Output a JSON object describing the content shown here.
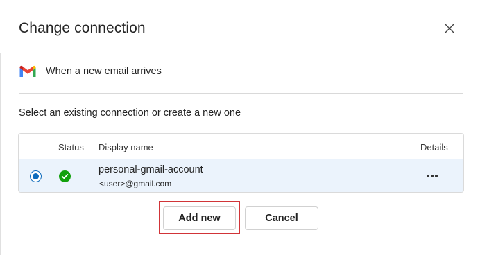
{
  "dialog": {
    "title": "Change connection",
    "close_icon": "close-icon"
  },
  "trigger": {
    "icon": "gmail-icon",
    "label": "When a new email arrives"
  },
  "prompt": "Select an existing connection or create a new one",
  "table": {
    "columns": {
      "status": "Status",
      "display_name": "Display name",
      "details": "Details"
    },
    "rows": [
      {
        "selected": true,
        "status": "ok",
        "status_icon": "checkmark-circle-icon",
        "display_name": "personal-gmail-account",
        "email": "<user>@gmail.com",
        "details_icon": "more-horizontal-icon"
      }
    ]
  },
  "buttons": {
    "add_new": "Add new",
    "cancel": "Cancel"
  },
  "colors": {
    "accent": "#0f6cbd",
    "success": "#13a10e",
    "highlight_outline": "#d13438",
    "selected_row": "#ebf3fc"
  }
}
